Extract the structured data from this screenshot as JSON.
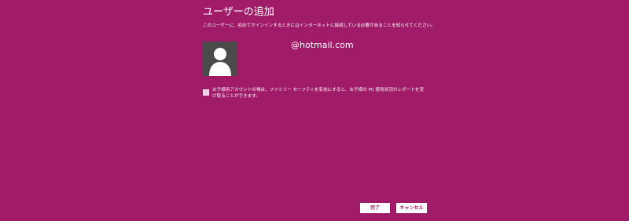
{
  "dialog": {
    "title": "ユーザーの追加",
    "subtitle": "このユーザーに、初めてサインインするときにはインターネットに接続している必要があることを知らせてください。",
    "account_email": "@hotmail.com",
    "avatar_icon": "user-silhouette-icon",
    "child_account": {
      "checked": false,
      "label": "お子様用アカウントの場合、ファミリー セーフティを有効にすると、お子様の PC 使用状況のレポートを受け取ることができます。"
    },
    "buttons": {
      "done_label": "完了",
      "cancel_label": "キャンセル"
    }
  },
  "colors": {
    "background": "#a01b68",
    "avatar_bg": "#4a4a4a",
    "text": "#ffffff"
  }
}
